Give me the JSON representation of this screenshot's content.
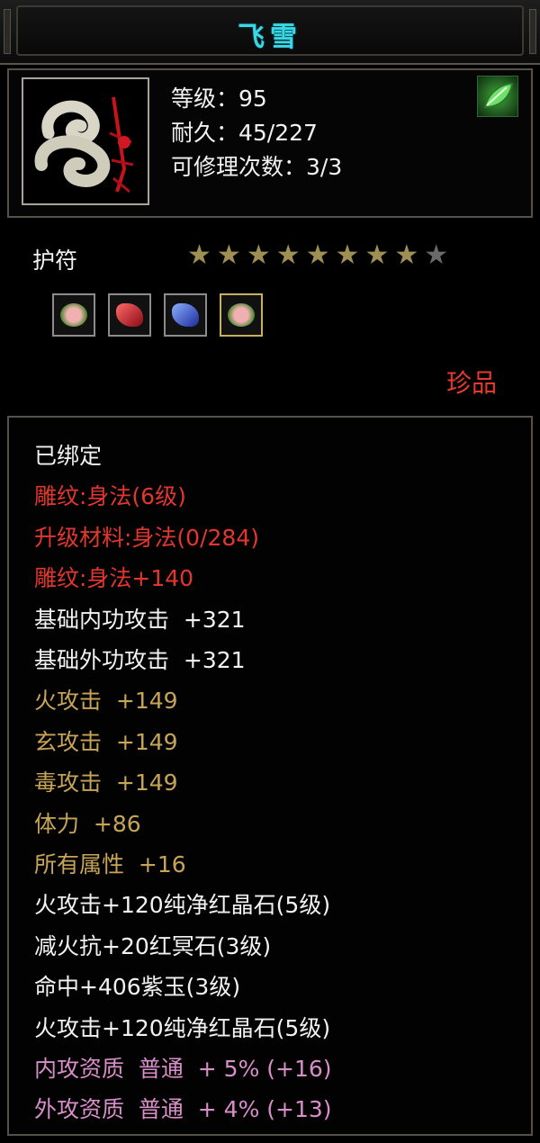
{
  "title": "飞雪",
  "item": {
    "level_text": "等级：95",
    "durability_text": "耐久：45/227",
    "repair_text": "可修理次数：3/3"
  },
  "type_label": "护符",
  "stars": {
    "total": 9,
    "filled": 8
  },
  "sockets": [
    {
      "icon": "pink-green-gem-icon"
    },
    {
      "icon": "red-crystal-icon"
    },
    {
      "icon": "blue-crystal-icon"
    },
    {
      "icon": "pink-green-gem-icon",
      "selected": true
    }
  ],
  "rarity": "珍品",
  "attributes": [
    {
      "text": "已绑定",
      "color": "white"
    },
    {
      "text": "雕纹:身法(6级)",
      "color": "red"
    },
    {
      "text": "升级材料:身法(0/284)",
      "color": "red"
    },
    {
      "text": "雕纹:身法+140",
      "color": "red"
    },
    {
      "text": "基础内功攻击  +321",
      "color": "white"
    },
    {
      "text": "基础外功攻击  +321",
      "color": "white"
    },
    {
      "text": "火攻击  +149",
      "color": "gold"
    },
    {
      "text": "玄攻击  +149",
      "color": "gold"
    },
    {
      "text": "毒攻击  +149",
      "color": "gold"
    },
    {
      "text": "体力  +86",
      "color": "gold"
    },
    {
      "text": "所有属性  +16",
      "color": "gold"
    },
    {
      "text": "火攻击+120纯净红晶石(5级)",
      "color": "white"
    },
    {
      "text": "减火抗+20红冥石(3级)",
      "color": "white"
    },
    {
      "text": "命中+406紫玉(3级)",
      "color": "white"
    },
    {
      "text": "火攻击+120纯净红晶石(5级)",
      "color": "white"
    },
    {
      "text": "内攻资质  普通  + 5% (+16)",
      "color": "pink"
    },
    {
      "text": "外攻资质  普通  + 4% (+13)",
      "color": "pink"
    }
  ],
  "colors": {
    "title": "#39d8e6",
    "red": "#e2362e",
    "gold": "#c8a456",
    "pink": "#d88ec8",
    "white": "#f2f2f2",
    "star_on": "#a08f52",
    "star_off": "#6a6a6a"
  }
}
